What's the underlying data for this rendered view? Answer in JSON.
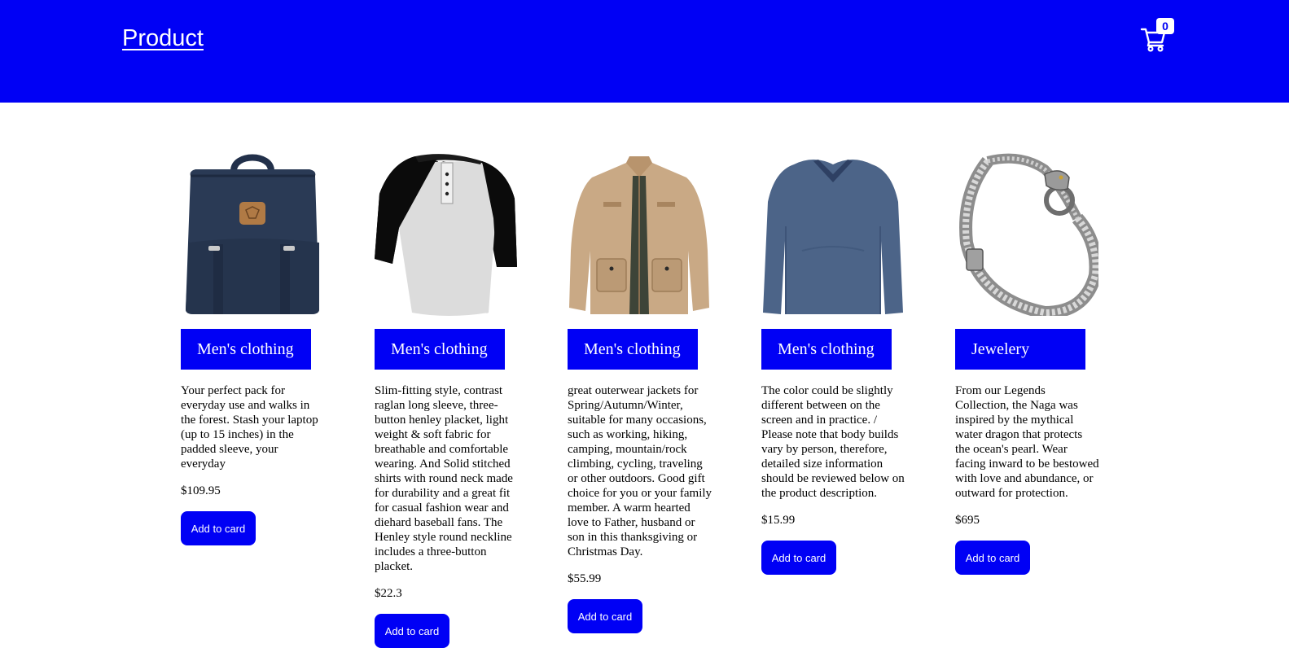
{
  "header": {
    "brand": "Product",
    "cart_count": "0",
    "background": "#0000f5",
    "cart_icon": "shopping-cart-icon"
  },
  "products": [
    {
      "image": "backpack",
      "category": "Men's clothing",
      "description": "Your perfect pack for everyday use and walks in the forest. Stash your laptop (up to 15 inches) in the padded sleeve, your everyday",
      "price": "$109.95",
      "button": "Add to card"
    },
    {
      "image": "raglan-henley-shirt",
      "category": "Men's clothing",
      "description": "Slim-fitting style, contrast raglan long sleeve, three-button henley placket, light weight & soft fabric for breathable and comfortable wearing. And Solid stitched shirts with round neck made for durability and a great fit for casual fashion wear and diehard baseball fans. The Henley style round neckline includes a three-button placket.",
      "price": "$22.3",
      "button": "Add to card"
    },
    {
      "image": "cotton-jacket",
      "category": "Men's clothing",
      "description": "great outerwear jackets for Spring/Autumn/Winter, suitable for many occasions, such as working, hiking, camping, mountain/rock climbing, cycling, traveling or other outdoors. Good gift choice for you or your family member. A warm hearted love to Father, husband or son in this thanksgiving or Christmas Day.",
      "price": "$55.99",
      "button": "Add to card"
    },
    {
      "image": "long-sleeve-tshirt",
      "category": "Men's clothing",
      "description": "The color could be slightly different between on the screen and in practice. / Please note that body builds vary by person, therefore, detailed size information should be reviewed below on the product description.",
      "price": "$15.99",
      "button": "Add to card"
    },
    {
      "image": "dragon-bracelet",
      "category": "Jewelery",
      "description": "From our Legends Collection, the Naga was inspired by the mythical water dragon that protects the ocean's pearl. Wear facing inward to be bestowed with love and abundance, or outward for protection.",
      "price": "$695",
      "button": "Add to card"
    }
  ]
}
